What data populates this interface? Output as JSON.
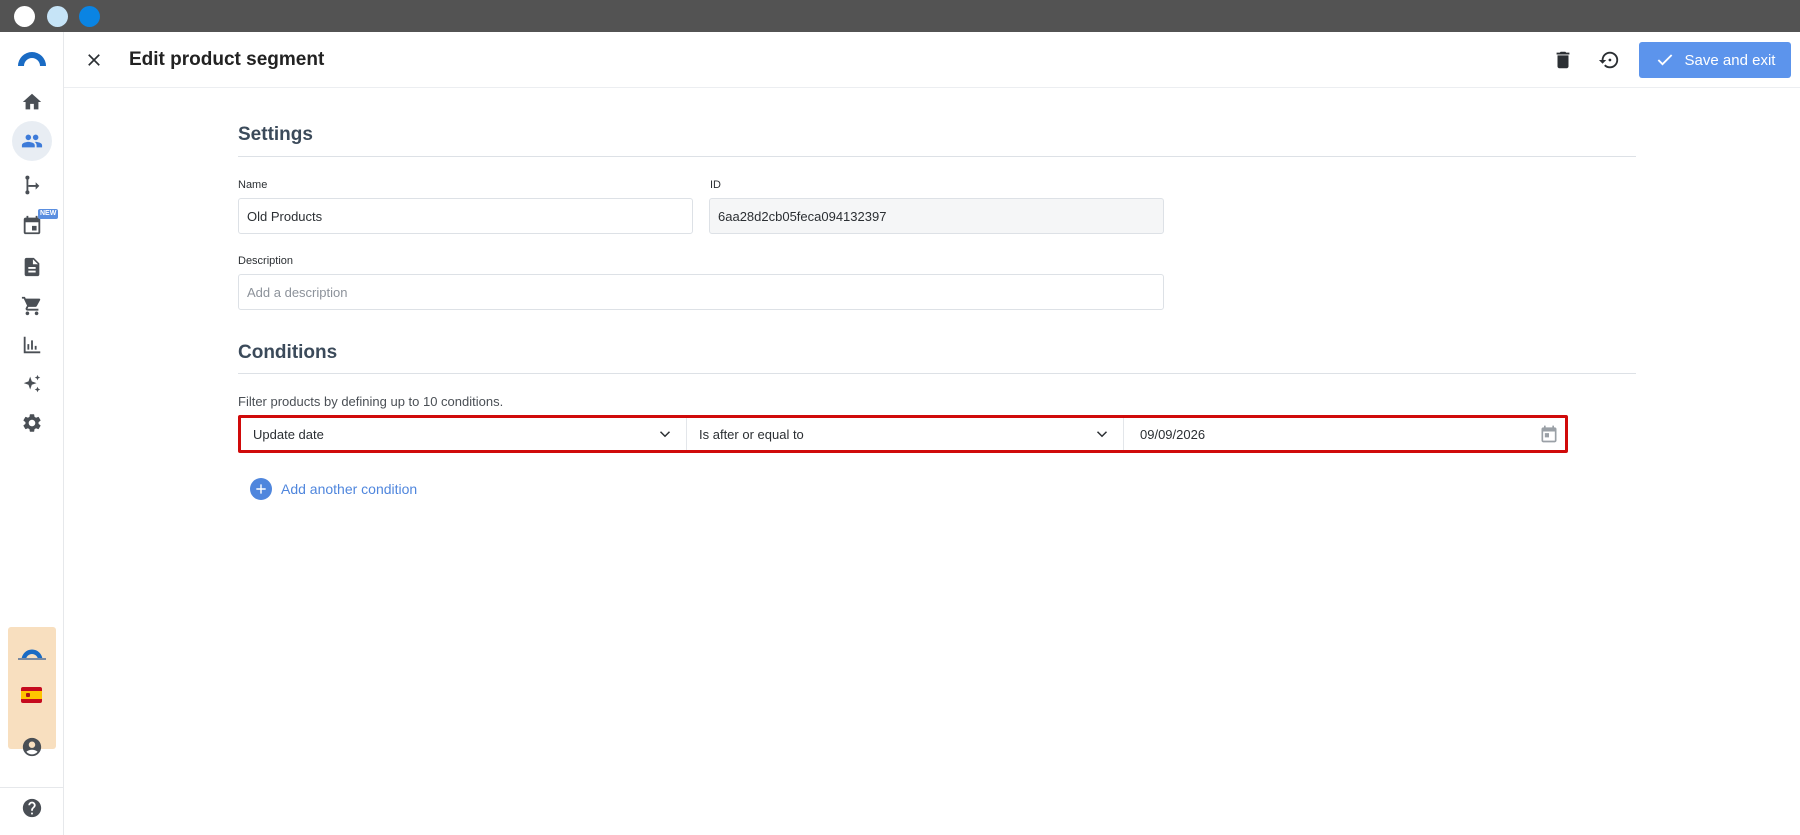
{
  "header": {
    "title": "Edit product segment",
    "save_label": "Save and exit"
  },
  "sidebar": {
    "items": [
      {
        "icon": "home-icon"
      },
      {
        "icon": "users-icon",
        "active": true
      },
      {
        "icon": "flow-icon"
      },
      {
        "icon": "calendar-icon",
        "badge": "NEW"
      },
      {
        "icon": "document-icon"
      },
      {
        "icon": "cart-icon"
      },
      {
        "icon": "chart-icon"
      },
      {
        "icon": "sparkle-icon"
      },
      {
        "icon": "gear-icon"
      },
      {
        "icon": "account-icon"
      },
      {
        "icon": "help-icon"
      }
    ]
  },
  "settings": {
    "title": "Settings",
    "name_label": "Name",
    "name_value": "Old Products",
    "id_label": "ID",
    "id_value": "6aa28d2cb05feca094132397",
    "description_label": "Description",
    "description_placeholder": "Add a description"
  },
  "conditions": {
    "title": "Conditions",
    "hint": "Filter products by defining up to 10 conditions.",
    "rows": [
      {
        "field": "Update date",
        "operator": "Is after or equal to",
        "value": "09/09/2026"
      }
    ],
    "add_label": "Add another condition"
  },
  "colors": {
    "accent": "#5c94ec",
    "highlight_border": "#d00a0a",
    "titlebar": "#535353"
  }
}
